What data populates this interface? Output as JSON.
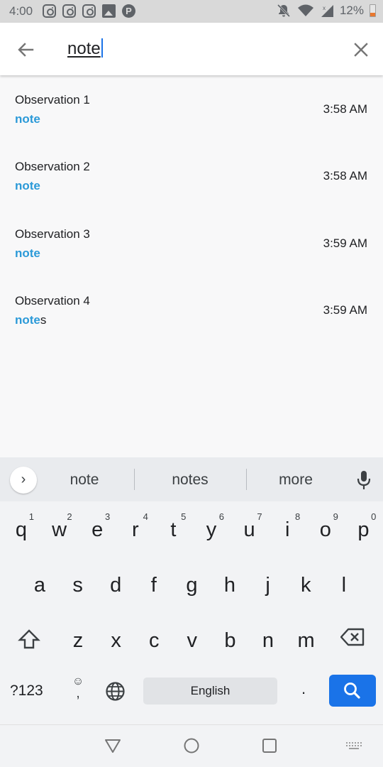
{
  "status_bar": {
    "time": "4:00",
    "battery": "12%",
    "left_icons": [
      "instagram-icon",
      "instagram-icon",
      "instagram-icon",
      "image-icon",
      "pocket-casts-icon"
    ],
    "right_icons": [
      "notifications-off-icon",
      "wifi-icon",
      "signal-icon",
      "battery-icon"
    ]
  },
  "search": {
    "query": "note",
    "back_icon": "arrow-left-icon",
    "clear_icon": "close-icon"
  },
  "results": [
    {
      "title": "Observation 1",
      "match": "note",
      "rest": "",
      "time": "3:58 AM"
    },
    {
      "title": "Observation 2",
      "match": "note",
      "rest": "",
      "time": "3:58 AM"
    },
    {
      "title": "Observation 3",
      "match": "note",
      "rest": "",
      "time": "3:59 AM"
    },
    {
      "title": "Observation 4",
      "match": "note",
      "rest": "s",
      "time": "3:59 AM"
    }
  ],
  "keyboard": {
    "suggestions": [
      "note",
      "notes",
      "more"
    ],
    "row1": [
      "q",
      "w",
      "e",
      "r",
      "t",
      "y",
      "u",
      "i",
      "o",
      "p"
    ],
    "row1_hints": [
      "1",
      "2",
      "3",
      "4",
      "5",
      "6",
      "7",
      "8",
      "9",
      "0"
    ],
    "row2": [
      "a",
      "s",
      "d",
      "f",
      "g",
      "h",
      "j",
      "k",
      "l"
    ],
    "row3": [
      "z",
      "x",
      "c",
      "v",
      "b",
      "n",
      "m"
    ],
    "symbols_label": "?123",
    "emoji_label": "☺",
    "comma_label": ",",
    "space_label": "English",
    "period_label": ".",
    "accent_color": "#1a73e8"
  },
  "nav_bar": {
    "icons": [
      "back-triangle-icon",
      "home-circle-icon",
      "recents-square-icon",
      "keyboard-switch-icon"
    ]
  },
  "colors": {
    "highlight": "#2c9ad8"
  }
}
